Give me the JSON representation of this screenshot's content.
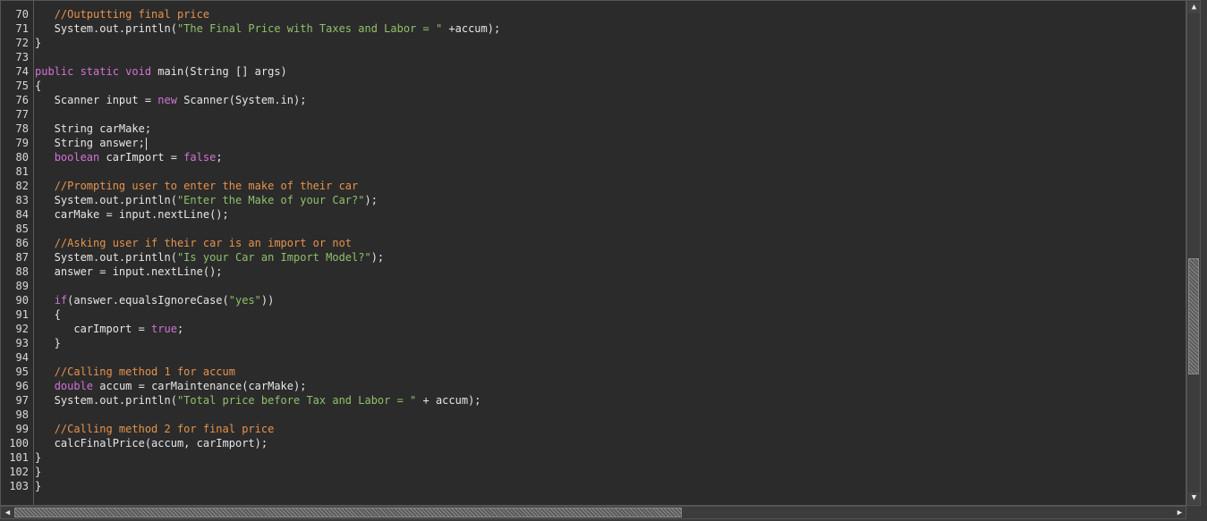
{
  "editor": {
    "lines": [
      {
        "n": "70",
        "segs": [
          {
            "t": "   "
          },
          {
            "t": "//Outputting final price",
            "c": "cm"
          }
        ]
      },
      {
        "n": "71",
        "segs": [
          {
            "t": "   System.out.println("
          },
          {
            "t": "\"The Final Price with Taxes and Labor = \"",
            "c": "str"
          },
          {
            "t": " +accum);"
          }
        ]
      },
      {
        "n": "72",
        "segs": [
          {
            "t": "}"
          }
        ]
      },
      {
        "n": "73",
        "segs": []
      },
      {
        "n": "74",
        "segs": [
          {
            "t": "public static void",
            "c": "kw"
          },
          {
            "t": " main(String [] args)"
          }
        ]
      },
      {
        "n": "75",
        "segs": [
          {
            "t": "{"
          }
        ]
      },
      {
        "n": "76",
        "segs": [
          {
            "t": "   Scanner input = "
          },
          {
            "t": "new",
            "c": "kw"
          },
          {
            "t": " Scanner(System.in);"
          }
        ]
      },
      {
        "n": "77",
        "segs": []
      },
      {
        "n": "78",
        "segs": [
          {
            "t": "   String carMake;"
          }
        ]
      },
      {
        "n": "79",
        "segs": [
          {
            "t": "   String answer;"
          }
        ],
        "caret": true
      },
      {
        "n": "80",
        "segs": [
          {
            "t": "   "
          },
          {
            "t": "boolean",
            "c": "kw"
          },
          {
            "t": " carImport = "
          },
          {
            "t": "false",
            "c": "kw"
          },
          {
            "t": ";"
          }
        ]
      },
      {
        "n": "81",
        "segs": []
      },
      {
        "n": "82",
        "segs": [
          {
            "t": "   "
          },
          {
            "t": "//Prompting user to enter the make of their car",
            "c": "cm"
          }
        ]
      },
      {
        "n": "83",
        "segs": [
          {
            "t": "   System.out.println("
          },
          {
            "t": "\"Enter the Make of your Car?\"",
            "c": "str"
          },
          {
            "t": ");"
          }
        ]
      },
      {
        "n": "84",
        "segs": [
          {
            "t": "   carMake = input.nextLine();"
          }
        ]
      },
      {
        "n": "85",
        "segs": []
      },
      {
        "n": "86",
        "segs": [
          {
            "t": "   "
          },
          {
            "t": "//Asking user if their car is an import or not",
            "c": "cm"
          }
        ]
      },
      {
        "n": "87",
        "segs": [
          {
            "t": "   System.out.println("
          },
          {
            "t": "\"Is your Car an Import Model?\"",
            "c": "str"
          },
          {
            "t": ");"
          }
        ]
      },
      {
        "n": "88",
        "segs": [
          {
            "t": "   answer = input.nextLine();"
          }
        ]
      },
      {
        "n": "89",
        "segs": []
      },
      {
        "n": "90",
        "segs": [
          {
            "t": "   "
          },
          {
            "t": "if",
            "c": "kw"
          },
          {
            "t": "(answer.equalsIgnoreCase("
          },
          {
            "t": "\"yes\"",
            "c": "str"
          },
          {
            "t": "))"
          }
        ]
      },
      {
        "n": "91",
        "segs": [
          {
            "t": "   {"
          }
        ]
      },
      {
        "n": "92",
        "segs": [
          {
            "t": "      carImport = "
          },
          {
            "t": "true",
            "c": "kw"
          },
          {
            "t": ";"
          }
        ]
      },
      {
        "n": "93",
        "segs": [
          {
            "t": "   }"
          }
        ]
      },
      {
        "n": "94",
        "segs": []
      },
      {
        "n": "95",
        "segs": [
          {
            "t": "   "
          },
          {
            "t": "//Calling method 1 for accum",
            "c": "cm"
          }
        ]
      },
      {
        "n": "96",
        "segs": [
          {
            "t": "   "
          },
          {
            "t": "double",
            "c": "kw"
          },
          {
            "t": " accum = carMaintenance(carMake);"
          }
        ]
      },
      {
        "n": "97",
        "segs": [
          {
            "t": "   System.out.println("
          },
          {
            "t": "\"Total price before Tax and Labor = \"",
            "c": "str"
          },
          {
            "t": " + accum);"
          }
        ]
      },
      {
        "n": "98",
        "segs": []
      },
      {
        "n": "99",
        "segs": [
          {
            "t": "   "
          },
          {
            "t": "//Calling method 2 for final price",
            "c": "cm"
          }
        ]
      },
      {
        "n": "100",
        "segs": [
          {
            "t": "   calcFinalPrice(accum, carImport);"
          }
        ]
      },
      {
        "n": "101",
        "segs": [
          {
            "t": "}"
          }
        ]
      },
      {
        "n": "102",
        "segs": [
          {
            "t": "}"
          }
        ]
      },
      {
        "n": "103",
        "segs": [
          {
            "t": "}"
          }
        ]
      }
    ]
  },
  "scrollbars": {
    "up_icon": "▲",
    "down_icon": "▼",
    "left_icon": "◀",
    "right_icon": "▶",
    "vertical_position": 0.62,
    "horizontal_position": 0.0
  },
  "colors": {
    "comment": "#e6934d",
    "keyword": "#d272d6",
    "string": "#8fc06a",
    "text": "#e6e6e6",
    "background": "#2b2b2b"
  }
}
